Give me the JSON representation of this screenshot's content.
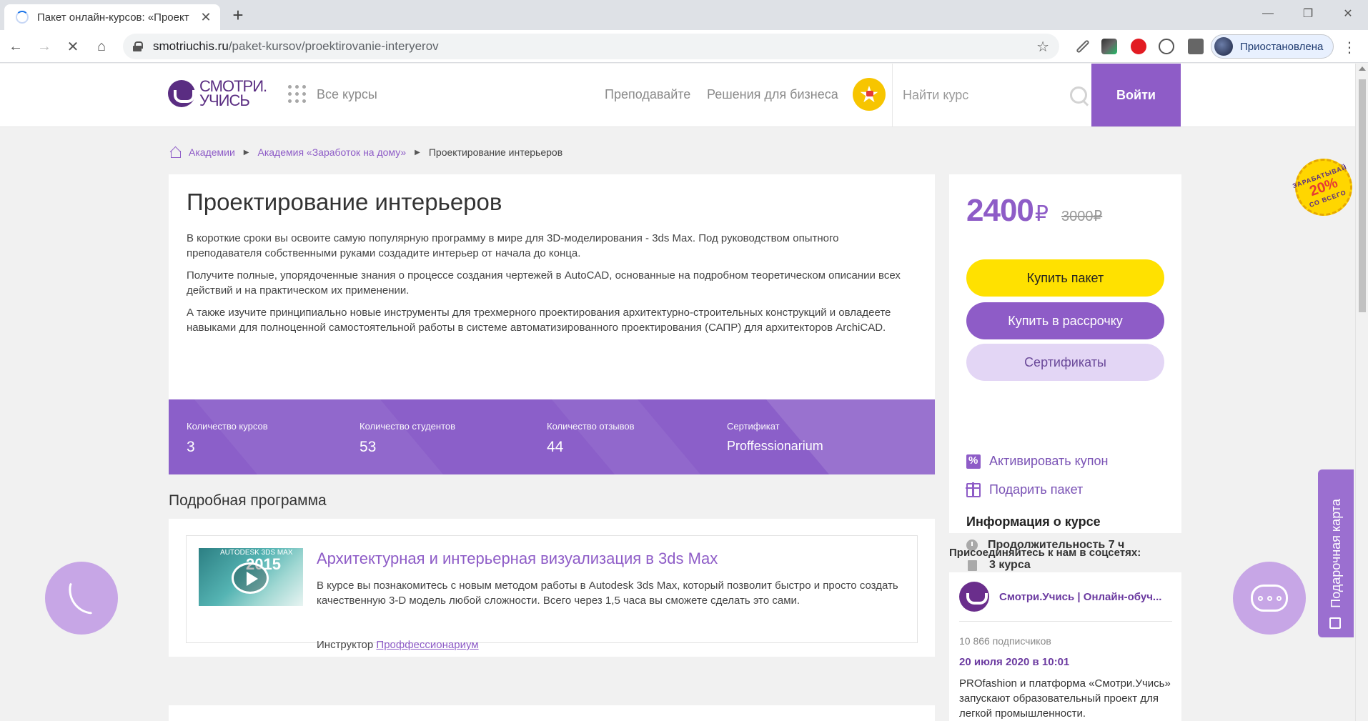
{
  "browser": {
    "tab_title": "Пакет онлайн-курсов: «Проект",
    "url_domain": "smotriuchis.ru",
    "url_path": "/paket-kursov/proektirovanie-interyerov",
    "profile_label": "Приостановлена"
  },
  "header": {
    "logo_line1": "СМОТРИ.",
    "logo_line2": "УЧИСЬ",
    "all_courses": "Все курсы",
    "nav": [
      "Преподавайте",
      "Решения для бизнеса"
    ],
    "search_placeholder": "Найти курс",
    "login": "Войти"
  },
  "breadcrumb": {
    "items": [
      "Академии",
      "Академия «Заработок на дому»"
    ],
    "current": "Проектирование интерьеров"
  },
  "course": {
    "title": "Проектирование интерьеров",
    "paragraphs": [
      "В короткие сроки вы освоите самую популярную программу в мире для 3D-моделирования - 3ds Max. Под руководством опытного преподавателя собственными руками создадите интерьер от начала до конца.",
      "Получите полные, упорядоченные знания о процессе создания чертежей в AutoCAD, основанные на подробном теоретическом описании всех действий и на практическом их применении.",
      "А также изучите принципиально новые инструменты для трехмерного проектирования архитектурно-строительных конструкций и овладеете навыками для полноценной самостоятельной работы в системе автоматизированного проектирования (САПР) для архитекторов ArchiCAD."
    ],
    "stats": [
      {
        "label": "Количество курсов",
        "value": "3"
      },
      {
        "label": "Количество студентов",
        "value": "53"
      },
      {
        "label": "Количество отзывов",
        "value": "44"
      },
      {
        "label": "Сертификат",
        "value": "Proffessionarium"
      }
    ]
  },
  "program": {
    "section_title": "Подробная программа",
    "items": [
      {
        "thumb_brand": "AUTODESK 3DS MAX",
        "thumb_year": "2015",
        "title": "Архитектурная и интерьерная визуализация в 3ds Max",
        "description": "В курсе вы познакомитесь с новым методом работы в Autodesk 3ds Max, который позволит быстро и просто создать качественную 3-D модель любой сложности. Всего через 1,5 часа вы сможете сделать это сами.",
        "instructor_label": "Инструктор",
        "instructor_name": "Проффессионариум"
      }
    ]
  },
  "sidebar": {
    "price": "2400",
    "currency": "₽",
    "old_price": "3000₽",
    "buy": "Купить пакет",
    "installment": "Купить в рассрочку",
    "certificates": "Сертификаты",
    "coupon": "Активировать купон",
    "gift": "Подарить пакет",
    "info_title": "Информация о курсе",
    "duration": "Продолжительность 7 ч",
    "courses_count": "3 курса"
  },
  "social": {
    "title": "Присоединяйтесь к нам в соцсетях:",
    "group_name": "Смотри.Учись | Онлайн-обуч...",
    "subscribers": "10 866 подписчиков",
    "post_date": "20 июля 2020 в 10:01",
    "post_text": "PROfashion и платформа «Смотри.Учись» запускают образовательный проект для легкой промышленности."
  },
  "floating": {
    "earn_top": "ЗАРАБАТЫВАЙ",
    "earn_pct": "20%",
    "earn_bottom": "СО ВСЕГО",
    "gift_card": "Подарочная карта"
  },
  "colors": {
    "brand_purple": "#8e5cc7",
    "buy_yellow": "#ffe100",
    "logo_purple": "#5a2d82"
  }
}
